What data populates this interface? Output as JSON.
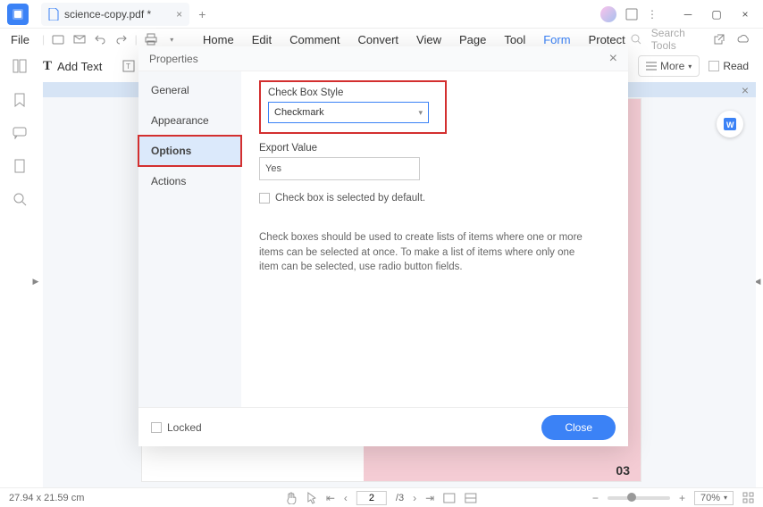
{
  "titlebar": {
    "tab_title": "science-copy.pdf *"
  },
  "menubar": {
    "file": "File",
    "items": [
      "Home",
      "Edit",
      "Comment",
      "Convert",
      "View",
      "Page",
      "Tool",
      "Form",
      "Protect"
    ],
    "active": "Form",
    "search_placeholder": "Search Tools"
  },
  "toolbar2": {
    "add_text": "Add Text",
    "more": "More",
    "read": "Read"
  },
  "dialog": {
    "title": "Properties",
    "sidebar": {
      "tabs": [
        "General",
        "Appearance",
        "Options",
        "Actions"
      ],
      "selected": "Options"
    },
    "options": {
      "style_label": "Check Box Style",
      "style_value": "Checkmark",
      "export_label": "Export Value",
      "export_value": "Yes",
      "default_cb_label": "Check box is selected by default.",
      "help_text": "Check boxes should be used to create lists of items where one or more items can be selected at once. To make a list of items where only one item can be selected, use radio button fields."
    },
    "footer": {
      "locked": "Locked",
      "close": "Close"
    }
  },
  "doc": {
    "page_number": "03"
  },
  "status": {
    "dimensions": "27.94 x 21.59 cm",
    "page_current": "2",
    "page_total": "/3",
    "zoom": "70%"
  }
}
